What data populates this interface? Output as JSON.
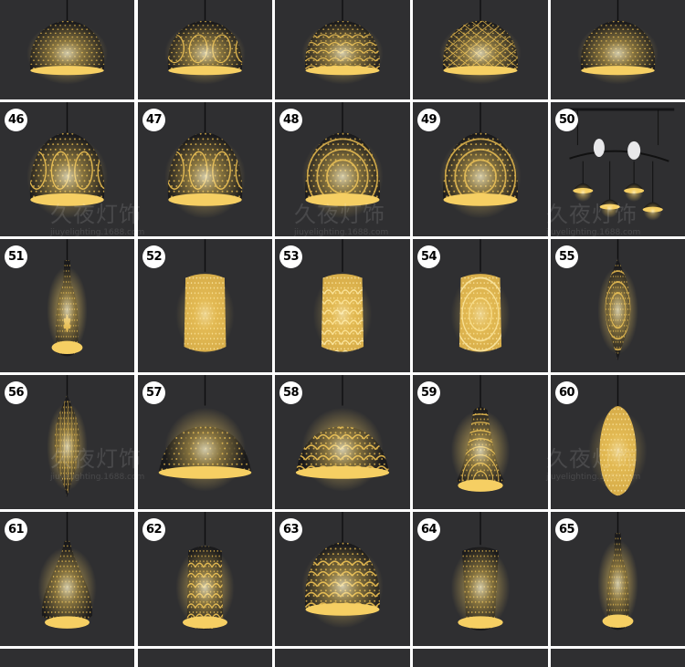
{
  "watermark": {
    "brand": "久夜灯饰",
    "url": "jiuyelighting.1688.com"
  },
  "colors": {
    "background": "#2f2f31",
    "gutter": "#ffffff",
    "metal": "#1a1a1c",
    "glow": "#f6cf63",
    "gold": "#d8ae4a",
    "badge": "#ffffff"
  },
  "tiles": [
    {
      "number": "",
      "shape": "dome",
      "pattern": "dots"
    },
    {
      "number": "",
      "shape": "dome",
      "pattern": "arabesque"
    },
    {
      "number": "",
      "shape": "dome",
      "pattern": "scallops"
    },
    {
      "number": "",
      "shape": "dome",
      "pattern": "lattice"
    },
    {
      "number": "",
      "shape": "dome",
      "pattern": "birds"
    },
    {
      "number": "46",
      "shape": "dome",
      "pattern": "arabesque"
    },
    {
      "number": "47",
      "shape": "dome",
      "pattern": "mosaic"
    },
    {
      "number": "48",
      "shape": "dome",
      "pattern": "rings"
    },
    {
      "number": "49",
      "shape": "dome",
      "pattern": "rings"
    },
    {
      "number": "50",
      "shape": "chandelier",
      "pattern": "birds"
    },
    {
      "number": "51",
      "shape": "bottle",
      "pattern": "flower"
    },
    {
      "number": "52",
      "shape": "cylinder",
      "pattern": "dots"
    },
    {
      "number": "53",
      "shape": "cylinder",
      "pattern": "scallops"
    },
    {
      "number": "54",
      "shape": "cylinder",
      "pattern": "rings"
    },
    {
      "number": "55",
      "shape": "lantern",
      "pattern": "rings"
    },
    {
      "number": "56",
      "shape": "lantern",
      "pattern": "ribs"
    },
    {
      "number": "57",
      "shape": "half-dome",
      "pattern": "flames"
    },
    {
      "number": "58",
      "shape": "half-dome",
      "pattern": "lace"
    },
    {
      "number": "59",
      "shape": "bell",
      "pattern": "fan"
    },
    {
      "number": "60",
      "shape": "oval",
      "pattern": "dots"
    },
    {
      "number": "61",
      "shape": "teardrop",
      "pattern": "dots"
    },
    {
      "number": "62",
      "shape": "cylinder-dark",
      "pattern": "scallops"
    },
    {
      "number": "63",
      "shape": "dome",
      "pattern": "scallops"
    },
    {
      "number": "64",
      "shape": "drum",
      "pattern": "dots"
    },
    {
      "number": "65",
      "shape": "bottle",
      "pattern": "dots"
    }
  ]
}
